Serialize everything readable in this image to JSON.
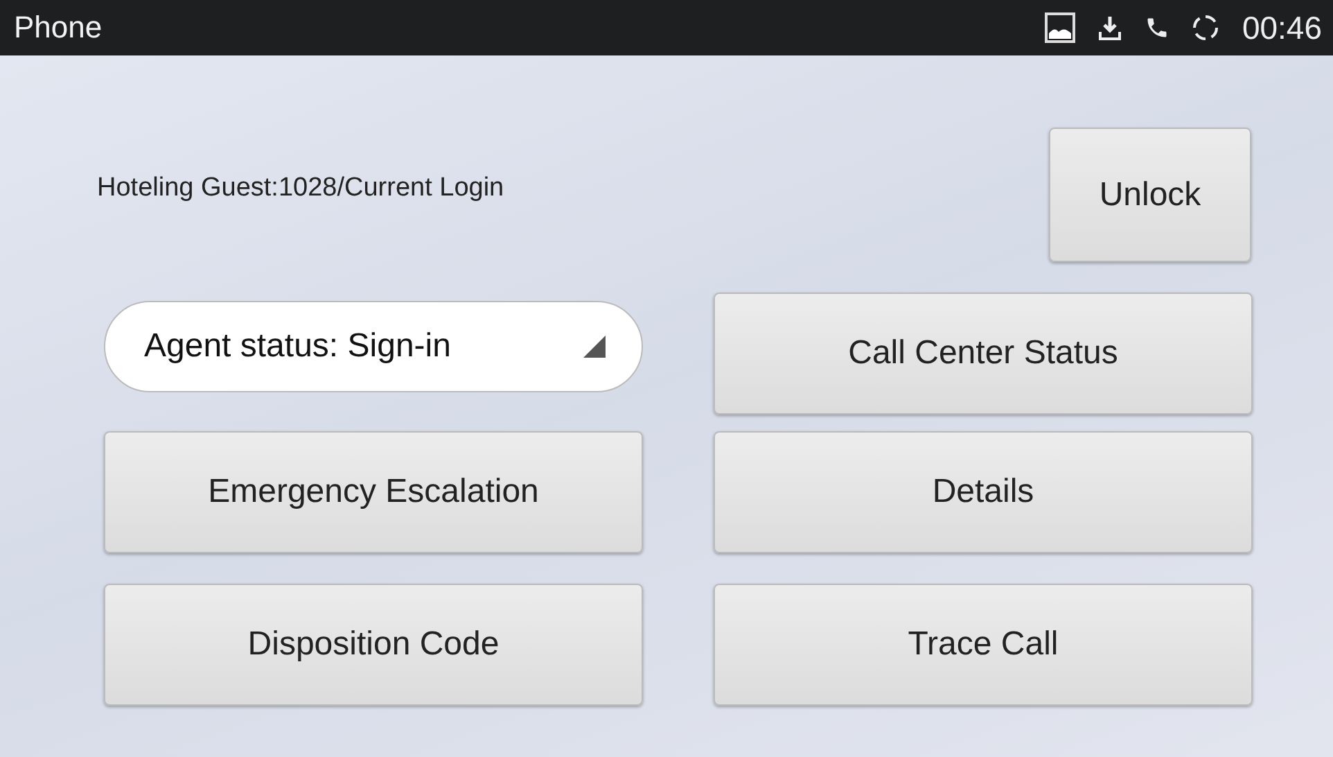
{
  "status_bar": {
    "title": "Phone",
    "time": "00:46"
  },
  "login_label": "Hoteling Guest:1028/Current Login",
  "unlock_button": "Unlock",
  "agent_status": {
    "value": "Agent status: Sign-in"
  },
  "buttons": [
    "Call Center Status",
    "Emergency Escalation",
    "Details",
    "Disposition Code",
    "Trace Call"
  ]
}
